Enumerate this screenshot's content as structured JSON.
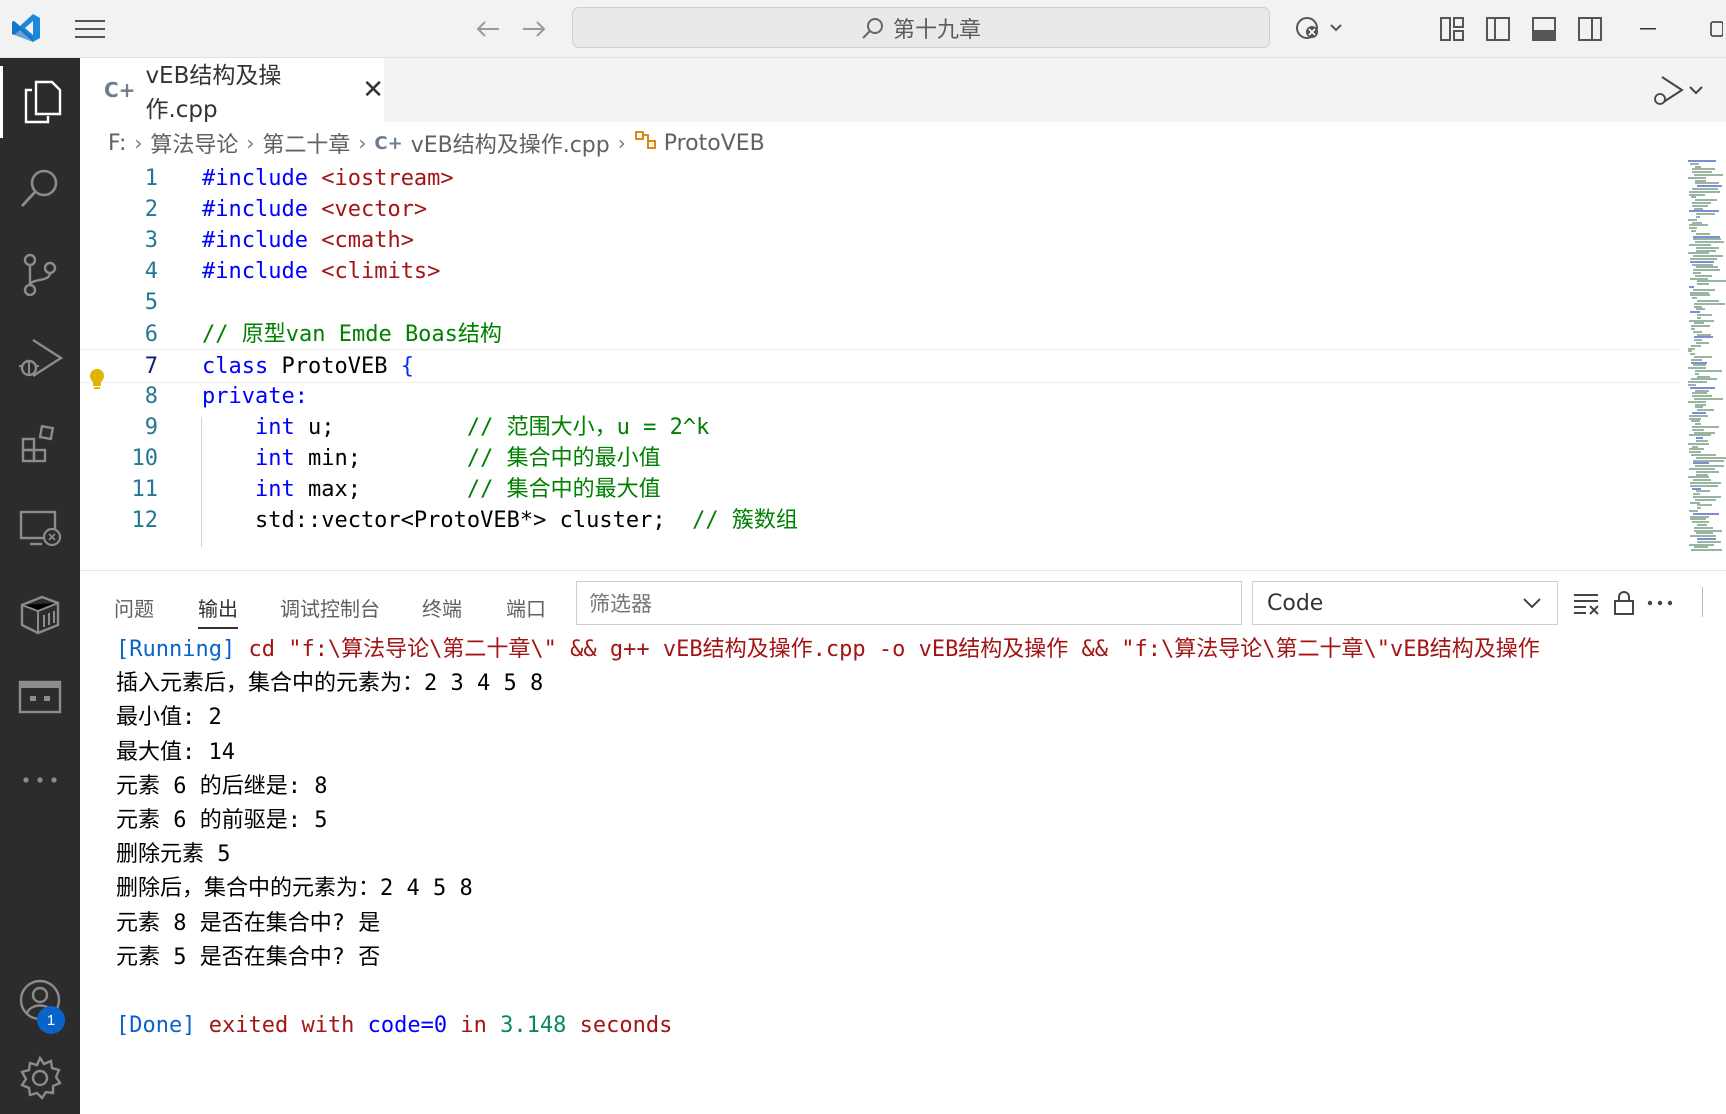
{
  "titlebar": {
    "search_text": "第十九章"
  },
  "tabs": {
    "active_label": "vEB结构及操作.cpp"
  },
  "breadcrumbs": {
    "drive": "F:",
    "folder1": "算法导论",
    "folder2": "第二十章",
    "file": "vEB结构及操作.cpp",
    "symbol": "ProtoVEB"
  },
  "editor": {
    "current_line": 7,
    "lines": [
      {
        "n": "1",
        "tokens": [
          [
            "inc",
            "#include "
          ],
          [
            "str",
            "<iostream>"
          ]
        ]
      },
      {
        "n": "2",
        "tokens": [
          [
            "inc",
            "#include "
          ],
          [
            "str",
            "<vector>"
          ]
        ]
      },
      {
        "n": "3",
        "tokens": [
          [
            "inc",
            "#include "
          ],
          [
            "str",
            "<cmath>"
          ]
        ]
      },
      {
        "n": "4",
        "tokens": [
          [
            "inc",
            "#include "
          ],
          [
            "str",
            "<climits>"
          ]
        ]
      },
      {
        "n": "5",
        "tokens": []
      },
      {
        "n": "6",
        "tokens": [
          [
            "cmt",
            "// 原型van Emde Boas结构"
          ]
        ]
      },
      {
        "n": "7",
        "tokens": [
          [
            "kw",
            "class "
          ],
          [
            "plain",
            "ProtoVEB "
          ],
          [
            "brace",
            "{"
          ]
        ]
      },
      {
        "n": "8",
        "tokens": [
          [
            "kw",
            "private:"
          ]
        ]
      },
      {
        "n": "9",
        "tokens": [
          [
            "plain",
            "    "
          ],
          [
            "kw",
            "int "
          ],
          [
            "plain",
            "u;          "
          ],
          [
            "cmt",
            "// 范围大小，u = 2^k"
          ]
        ]
      },
      {
        "n": "10",
        "tokens": [
          [
            "plain",
            "    "
          ],
          [
            "kw",
            "int "
          ],
          [
            "plain",
            "min;        "
          ],
          [
            "cmt",
            "// 集合中的最小值"
          ]
        ]
      },
      {
        "n": "11",
        "tokens": [
          [
            "plain",
            "    "
          ],
          [
            "kw",
            "int "
          ],
          [
            "plain",
            "max;        "
          ],
          [
            "cmt",
            "// 集合中的最大值"
          ]
        ]
      },
      {
        "n": "12",
        "tokens": [
          [
            "plain",
            "    std::vector<ProtoVEB*> cluster;  "
          ],
          [
            "cmt",
            "// 簇数组"
          ]
        ]
      }
    ]
  },
  "panel": {
    "tabs": [
      "问题",
      "输出",
      "调试控制台",
      "终端",
      "端口"
    ],
    "active_tab": "输出",
    "filter_placeholder": "筛选器",
    "channel": "Code",
    "running_tag": "[Running]",
    "running_cmd": " cd \"f:\\算法导论\\第二十章\\\" && g++ vEB结构及操作.cpp -o vEB结构及操作 && \"f:\\算法导论\\第二十章\\\"vEB结构及操作",
    "output_lines": [
      "插入元素后，集合中的元素为：2 3 4 5 8",
      "最小值: 2",
      "最大值: 14",
      "元素 6 的后继是: 8",
      "元素 6 的前驱是: 5",
      "删除元素 5",
      "删除后，集合中的元素为：2 4 5 8",
      "元素 8 是否在集合中? 是",
      "元素 5 是否在集合中? 否",
      ""
    ],
    "done_tag": "[Done]",
    "done_text1": " exited with ",
    "done_code": "code=0",
    "done_text2": " in ",
    "done_time": "3.148",
    "done_text3": " seconds"
  },
  "activity": {
    "account_badge": "1"
  }
}
